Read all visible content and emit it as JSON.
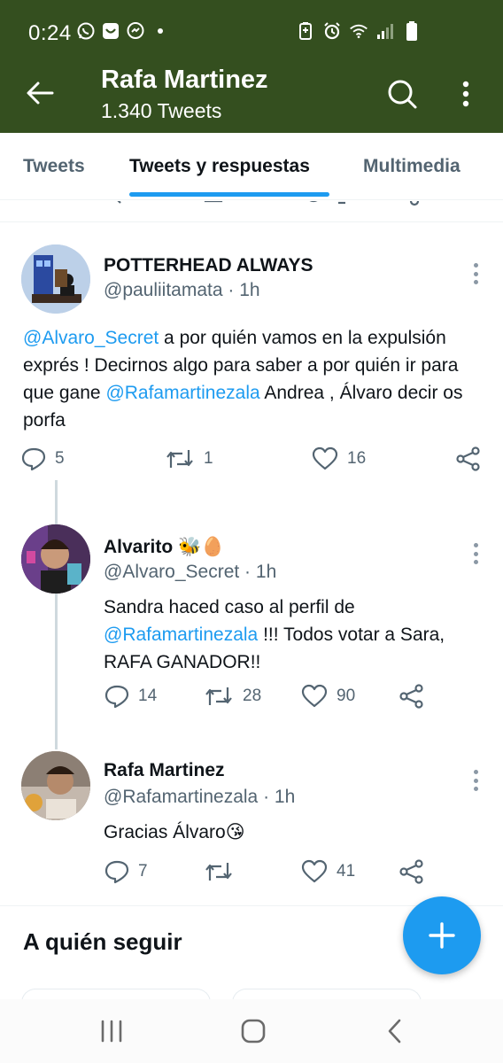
{
  "status_bar": {
    "time": "0:24",
    "left_icons": [
      "whatsapp-icon",
      "media-icon",
      "messenger-icon",
      "dot-icon"
    ],
    "right_icons": [
      "battery-saver-icon",
      "alarm-icon",
      "wifi-icon",
      "signal-icon",
      "battery-icon"
    ]
  },
  "header": {
    "title": "Rafa Martinez",
    "subtitle": "1.340 Tweets",
    "bg_color": "#344f1f"
  },
  "tabs": [
    {
      "label": "Tweets",
      "active": false
    },
    {
      "label": "Tweets y respuestas",
      "active": true
    },
    {
      "label": "Multimedia",
      "active": false
    }
  ],
  "tweets": [
    {
      "name": "POTTERHEAD ALWAYS",
      "emoji": "",
      "handle": "@pauliitamata",
      "time": "1h",
      "body": [
        {
          "type": "mention",
          "text": "@Alvaro_Secret"
        },
        {
          "type": "text",
          "text": " a por quién vamos en la expulsión exprés ! Decirnos algo para saber a por quién ir para que gane "
        },
        {
          "type": "mention",
          "text": "@Rafamartinezala"
        },
        {
          "type": "text",
          "text": " Andrea , Álvaro decir os porfa"
        }
      ],
      "replies": "5",
      "retweets": "1",
      "likes": "16"
    },
    {
      "name": "Alvarito",
      "emoji": "🐝🥚",
      "handle": "@Alvaro_Secret",
      "time": "1h",
      "body": [
        {
          "type": "text",
          "text": "Sandra haced caso al perfil de "
        },
        {
          "type": "mention",
          "text": "@Rafamartinezala"
        },
        {
          "type": "text",
          "text": " !!! Todos votar a Sara, RAFA GANADOR!!"
        }
      ],
      "replies": "14",
      "retweets": "28",
      "likes": "90"
    },
    {
      "name": "Rafa Martinez",
      "emoji": "",
      "handle": "@Rafamartinezala",
      "time": "1h",
      "body": [
        {
          "type": "text",
          "text": "Gracias Álvaro😘"
        }
      ],
      "replies": "7",
      "retweets": "",
      "likes": "41"
    }
  ],
  "who_to_follow": {
    "title": "A quién seguir"
  },
  "fab": {
    "icon": "plus-icon",
    "color": "#1d9bf0"
  },
  "navigation_bar": [
    "recent-apps-icon",
    "home-icon",
    "back-icon"
  ]
}
